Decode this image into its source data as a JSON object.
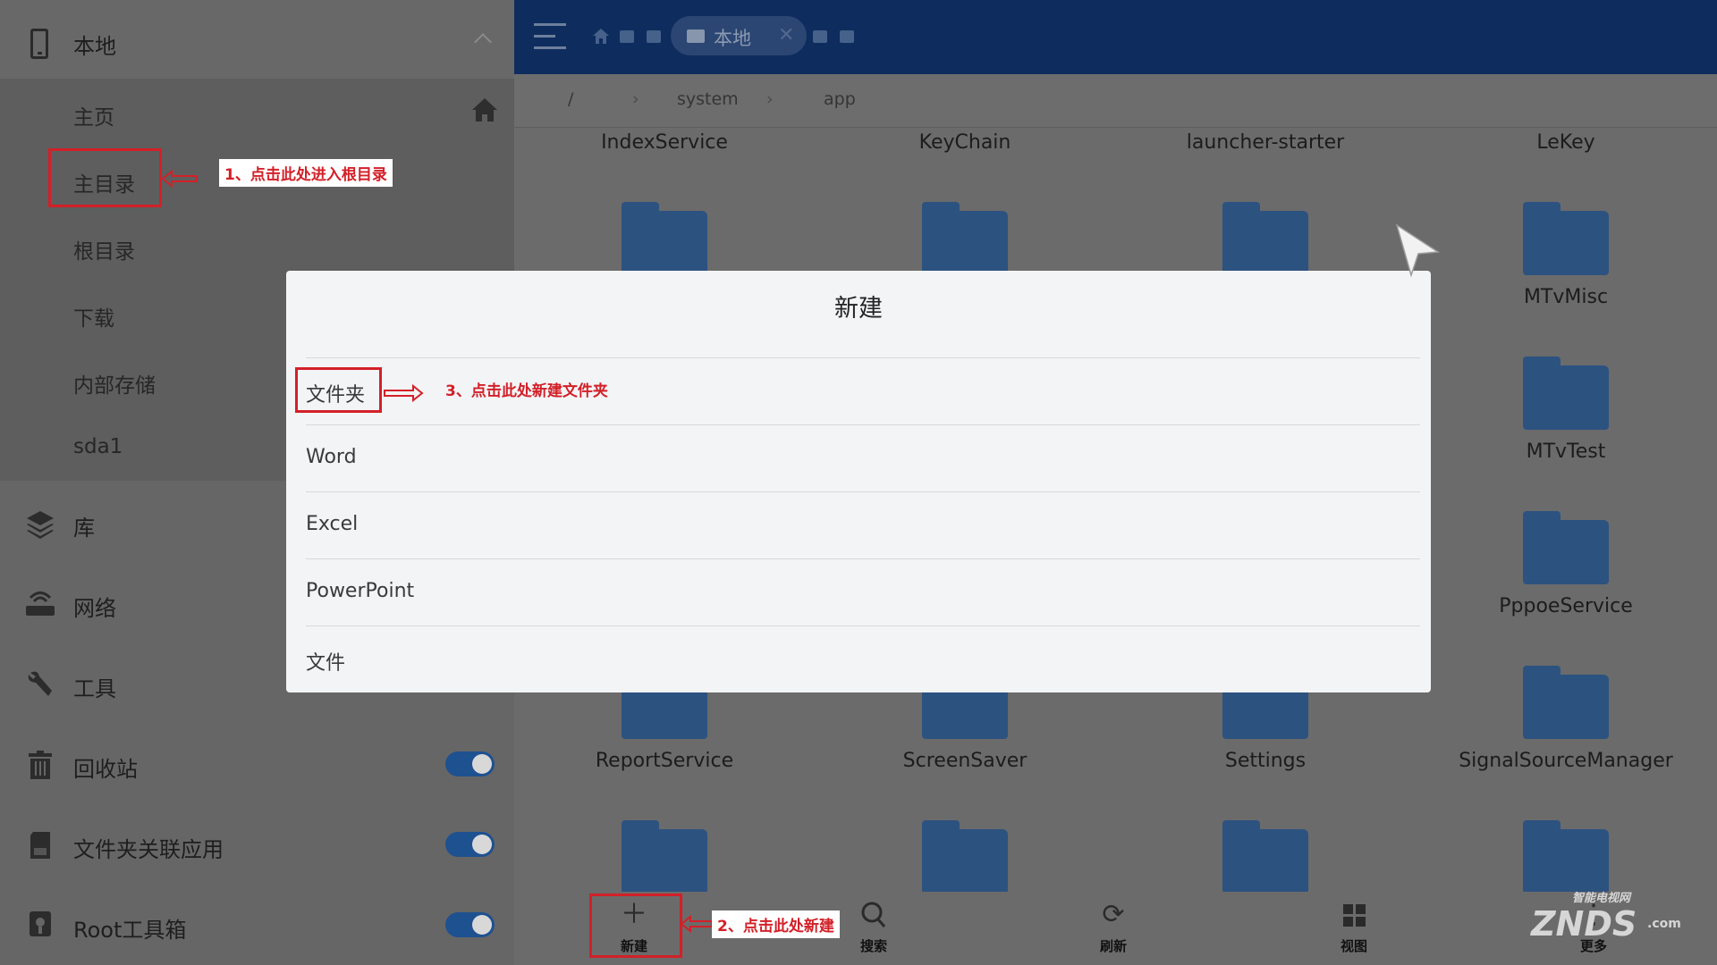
{
  "sidebar": {
    "header": {
      "title": "本地"
    },
    "sub_items": [
      "主页",
      "主目录",
      "根目录",
      "下载",
      "内部存储",
      "sda1"
    ],
    "items": [
      {
        "label": "库"
      },
      {
        "label": "网络"
      },
      {
        "label": "工具"
      },
      {
        "label": "回收站",
        "toggle": true
      },
      {
        "label": "文件夹关联应用",
        "toggle": true
      },
      {
        "label": "Root工具箱",
        "toggle": true
      }
    ]
  },
  "topbar": {
    "active_tab": "本地",
    "close_glyph": "✕"
  },
  "breadcrumb": {
    "root": "/",
    "sep": "›",
    "parts": [
      "system",
      "app"
    ]
  },
  "grid": {
    "row0": [
      "IndexService",
      "KeyChain",
      "launcher-starter",
      "LeKey"
    ],
    "col3": [
      "MTvMisc",
      "MTvTest",
      "PppoeService"
    ],
    "row_bottom": [
      "ReportService",
      "ScreenSaver",
      "Settings",
      "SignalSourceManager"
    ]
  },
  "bottombar": {
    "new": "新建",
    "search": "搜索",
    "refresh": "刷新",
    "view": "视图",
    "more": "更多"
  },
  "dialog": {
    "title": "新建",
    "options": [
      "文件夹",
      "Word",
      "Excel",
      "PowerPoint",
      "文件"
    ]
  },
  "annotations": {
    "note1": "1、点击此处进入根目录",
    "note2": "2、点击此处新建",
    "note3": "3、点击此处新建文件夹"
  },
  "watermark": {
    "brand": "ZNDS",
    "sub": "智能电视网",
    "suffix": ".com"
  },
  "colors": {
    "topbar": "#0e2c5e",
    "folder": "#2c5280",
    "annotation_red": "#d32028",
    "toggle_on": "#1e5190"
  }
}
